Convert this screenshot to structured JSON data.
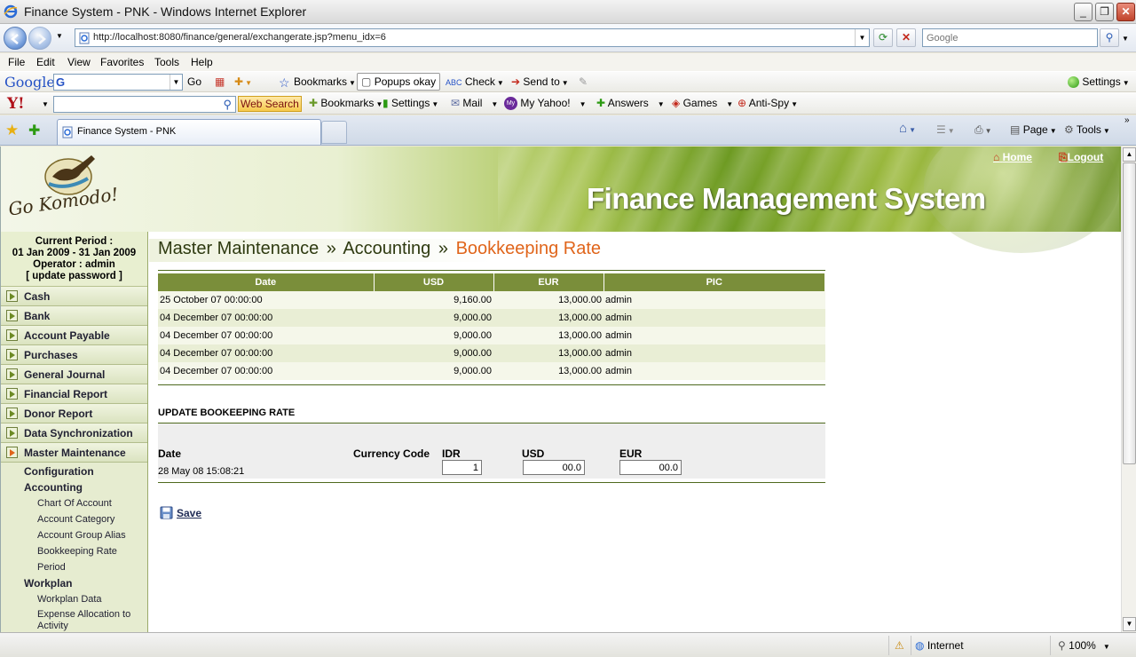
{
  "browser": {
    "window_title": "Finance System - PNK - Windows Internet Explorer",
    "url": "http://localhost:8080/finance/general/exchangerate.jsp?menu_idx=6",
    "search_placeholder": "Google",
    "menu": [
      "File",
      "Edit",
      "View",
      "Favorites",
      "Tools",
      "Help"
    ],
    "google_toolbar": {
      "logo": "Google",
      "go": "Go",
      "bookmarks": "Bookmarks",
      "popups": "Popups okay",
      "check": "Check",
      "send_to": "Send to",
      "settings": "Settings"
    },
    "yahoo_toolbar": {
      "logo": "Y!",
      "web_search": "Web Search",
      "bookmarks": "Bookmarks",
      "settings": "Settings",
      "mail": "Mail",
      "my_yahoo": "My Yahoo!",
      "answers": "Answers",
      "games": "Games",
      "anti_spy": "Anti-Spy"
    },
    "tab_title": "Finance System - PNK",
    "commands": {
      "page": "Page",
      "tools": "Tools"
    },
    "status": {
      "zone": "Internet",
      "zoom": "100%"
    }
  },
  "header": {
    "logo_text": "Go Komodo!",
    "system_title": "Finance Management System",
    "home_link": "Home",
    "logout_link": "Logout"
  },
  "sidebar": {
    "period_label": "Current Period :",
    "period_range": "01 Jan 2009 - 31 Jan 2009",
    "operator": "Operator : admin",
    "update_password": "[ update password ]",
    "items": [
      "Cash",
      "Bank",
      "Account Payable",
      "Purchases",
      "General Journal",
      "Financial Report",
      "Donor Report",
      "Data Synchronization",
      "Master Maintenance"
    ],
    "submenu": {
      "configuration": "Configuration",
      "accounting": "Accounting",
      "accounting_items": [
        "Chart Of Account",
        "Account Category",
        "Account Group Alias",
        "Bookkeeping Rate",
        "Period"
      ],
      "workplan": "Workplan",
      "workplan_items": [
        "Workplan Data",
        "Expense Allocation to Activity"
      ]
    }
  },
  "breadcrumb": {
    "level1": "Master Maintenance",
    "sep": "»",
    "level2": "Accounting",
    "current": "Bookkeeping Rate"
  },
  "rate_table": {
    "columns": [
      "Date",
      "USD",
      "EUR",
      "PIC"
    ],
    "rows": [
      [
        "25 October 07 00:00:00",
        "9,160.00",
        "13,000.00",
        "admin"
      ],
      [
        "04 December 07 00:00:00",
        "9,000.00",
        "13,000.00",
        "admin"
      ],
      [
        "04 December 07 00:00:00",
        "9,000.00",
        "13,000.00",
        "admin"
      ],
      [
        "04 December 07 00:00:00",
        "9,000.00",
        "13,000.00",
        "admin"
      ],
      [
        "04 December 07 00:00:00",
        "9,000.00",
        "13,000.00",
        "admin"
      ]
    ]
  },
  "update_form": {
    "title": "UPDATE BOOKEEPING RATE",
    "date_label": "Date",
    "currency_label": "Currency Code",
    "idr_label": "IDR",
    "usd_label": "USD",
    "eur_label": "EUR",
    "date_value": "28 May 08 15:08:21",
    "idr_value": "1",
    "usd_value": "00.0",
    "eur_value": "00.0",
    "save_label": "Save"
  },
  "colors": {
    "accent_orange": "#e0651b",
    "table_header": "#7a8e3a",
    "sidebar_bg": "#dfe6c8"
  }
}
